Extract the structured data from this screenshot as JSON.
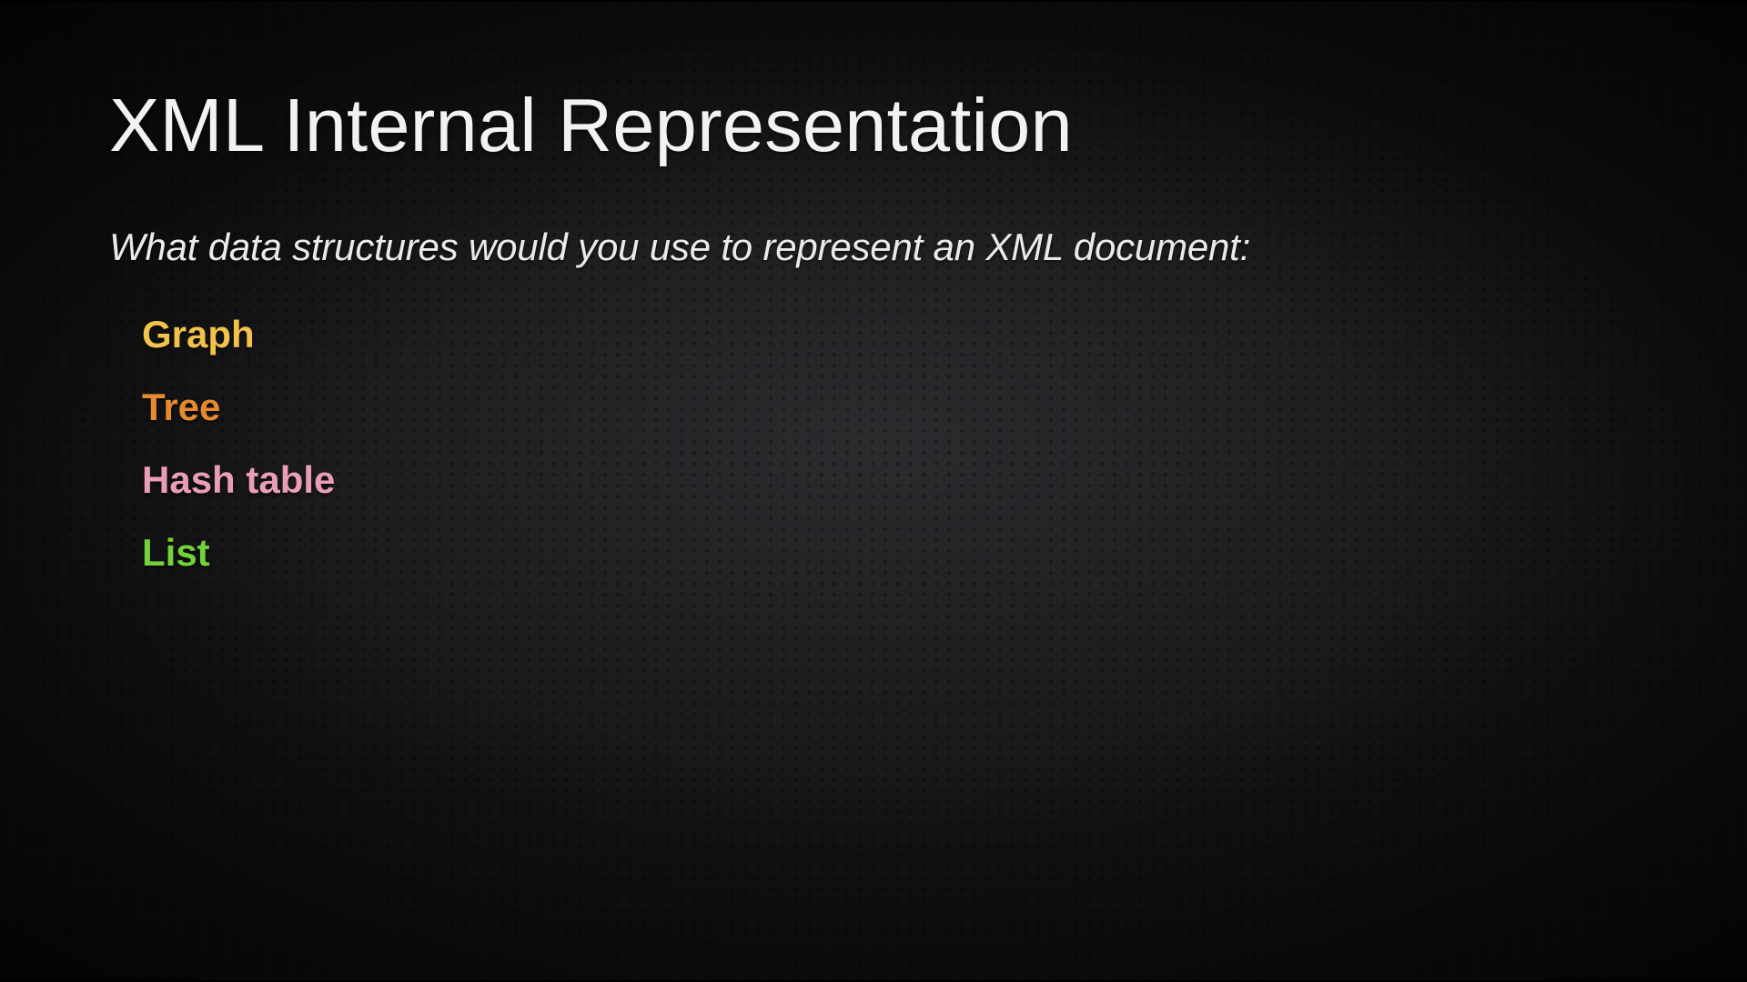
{
  "slide": {
    "title": "XML Internal Representation",
    "question": "What data structures would you use to represent an XML document:",
    "options": [
      {
        "label": "Graph",
        "color": "#f2c24b"
      },
      {
        "label": "Tree",
        "color": "#e58a2e"
      },
      {
        "label": "Hash table",
        "color": "#ea9eb4"
      },
      {
        "label": "List",
        "color": "#74d23a"
      }
    ]
  }
}
